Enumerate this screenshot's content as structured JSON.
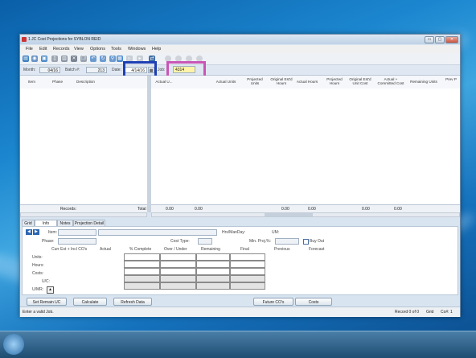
{
  "window": {
    "title": "1 JC Cost Projections for SYBLON REID"
  },
  "menu": [
    "File",
    "Edit",
    "Records",
    "View",
    "Options",
    "Tools",
    "Windows",
    "Help"
  ],
  "filter": {
    "month_label": "Month:",
    "month_value": "04/16",
    "batch_label": "Batch #:",
    "batch_value": "213",
    "date_label": "Date:",
    "date_value": "4/14/16",
    "job_label": "Job:",
    "job_value": "4314"
  },
  "grid": {
    "left_headers": [
      "Item",
      "Phase",
      "Description"
    ],
    "right_headers": [
      "Actual U...",
      "Actual Units",
      "Projected Units",
      "Original Est'd Hours",
      "Actual Hours",
      "Projected Hours",
      "Original Est'd Unit Cost",
      "Actual + Committed Cost",
      "Remaining Units",
      "Prev P"
    ],
    "records_label": "Records:",
    "total_label": "Total",
    "totals": [
      "0.00",
      "0.00",
      "0.00",
      "0.00",
      "0.00",
      "0.00"
    ]
  },
  "tabs": [
    "Grid",
    "Info",
    "Notes",
    "Projection Detail"
  ],
  "info": {
    "item_label": "Item:",
    "phase_label": "Phase:",
    "hrs_label": "Hrs/ManDay:",
    "um_label": "UM:",
    "cost_type_label": "Cost Type:",
    "min_proj_label": "Min. Proj.%:",
    "buy_out_label": "Buy Out",
    "col_headers": [
      "Curr Est + Incl CO's",
      "Actual",
      "% Complete",
      "Over / Under",
      "Remaining",
      "Final",
      "Previous",
      "Forecast"
    ],
    "row_labels": [
      "Units:",
      "Hours:",
      "Costs:",
      "U/C:",
      "U/MR:"
    ]
  },
  "buttons": [
    "Set Remain UC",
    "Calculate",
    "Refresh Data",
    "Future CO's",
    "Costs"
  ],
  "status": {
    "message": "Enter a valid Job.",
    "record": "Record 0 of 0",
    "mode": "Grid",
    "co": "Co#: 1"
  },
  "colors": {
    "highlight_date": "#1f3fb5",
    "highlight_job": "#c956b6",
    "job_field_bg": "#fff3a8"
  }
}
